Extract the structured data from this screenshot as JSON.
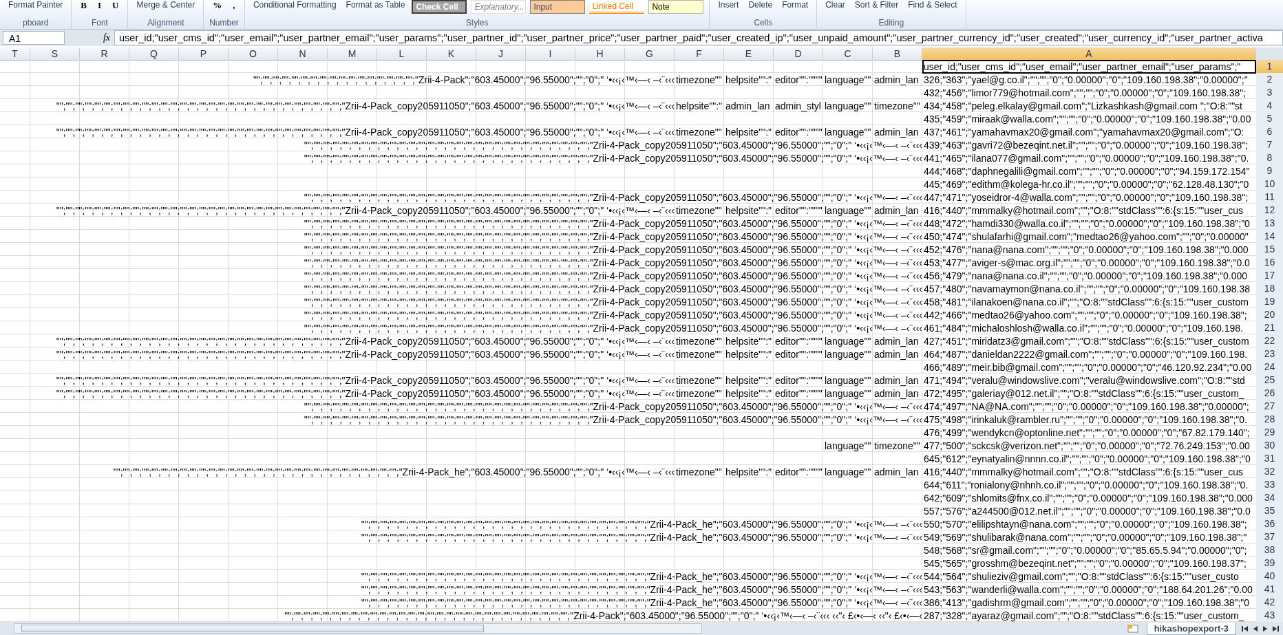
{
  "ribbon": {
    "groups": [
      {
        "label": "pboard",
        "items": [
          {
            "kind": "tool",
            "text": "Format Painter"
          }
        ]
      },
      {
        "label": "Font",
        "items": [
          {
            "kind": "glyph",
            "text": "B"
          },
          {
            "kind": "glyph",
            "text": "I"
          },
          {
            "kind": "glyph",
            "text": "U"
          }
        ]
      },
      {
        "label": "Alignment",
        "items": [
          {
            "kind": "tool",
            "text": "Merge & Center"
          }
        ]
      },
      {
        "label": "Number",
        "items": [
          {
            "kind": "symbol",
            "text": "%"
          },
          {
            "kind": "symbol",
            "text": ","
          }
        ]
      },
      {
        "label": "Styles",
        "items": [
          {
            "kind": "tool",
            "text": "Conditional Formatting"
          },
          {
            "kind": "tool",
            "text": "Format as Table"
          },
          {
            "kind": "check",
            "text": "Check Cell"
          },
          {
            "kind": "explanatory",
            "text": "Explanatory..."
          },
          {
            "kind": "input",
            "text": "Input"
          },
          {
            "kind": "linked",
            "text": "Linked Cell"
          },
          {
            "kind": "note",
            "text": "Note"
          }
        ]
      },
      {
        "label": "Cells",
        "items": [
          {
            "kind": "tool",
            "text": "Insert"
          },
          {
            "kind": "tool",
            "text": "Delete"
          },
          {
            "kind": "tool",
            "text": "Format"
          }
        ]
      },
      {
        "label": "Editing",
        "items": [
          {
            "kind": "tool",
            "text": "Clear"
          },
          {
            "kind": "tool",
            "text": "Sort & Filter"
          },
          {
            "kind": "tool",
            "text": "Find & Select"
          }
        ]
      }
    ]
  },
  "formula_bar": {
    "name_box": "A1",
    "fx": "fx",
    "formula": "user_id;\"user_cms_id\";\"user_email\";\"user_partner_email\";\"user_params\";\"user_partner_id\";\"user_partner_price\";\"user_partner_paid\";\"user_created_ip\";\"user_unpaid_amount\";\"user_partner_currency_id\";\"user_created\";\"user_currency_id\";\"user_partner_activa"
  },
  "columns": [
    {
      "label": "T",
      "selected": false
    },
    {
      "label": "S",
      "selected": false
    },
    {
      "label": "R",
      "selected": false
    },
    {
      "label": "Q",
      "selected": false
    },
    {
      "label": "P",
      "selected": false
    },
    {
      "label": "O",
      "selected": false
    },
    {
      "label": "N",
      "selected": false
    },
    {
      "label": "M",
      "selected": false
    },
    {
      "label": "L",
      "selected": false
    },
    {
      "label": "K",
      "selected": false
    },
    {
      "label": "J",
      "selected": false
    },
    {
      "label": "I",
      "selected": false
    },
    {
      "label": "H",
      "selected": false
    },
    {
      "label": "G",
      "selected": false
    },
    {
      "label": "F",
      "selected": false
    },
    {
      "label": "E",
      "selected": false
    },
    {
      "label": "D",
      "selected": false
    },
    {
      "label": "C",
      "selected": false
    },
    {
      "label": "B",
      "selected": false
    },
    {
      "label": "A",
      "selected": true
    }
  ],
  "rows": [
    {
      "number": "1",
      "selected": true,
      "cells": [
        {
          "kind": "text",
          "text": "user_id;\"user_cms_id\";\"user_email\";\"user_partner_email\";\"user_params\";\""
        }
      ]
    },
    {
      "number": "2",
      "selected": false,
      "cells": [
        {
          "kind": "overflow",
          "text": "\"\";\"\";\"\";\"\";\"\";\"\";\"\";\"\";\"\";\"\";\"\";\"\";\"\";\"\";\"\";\"\";\"\";\"Zrii-4-Pack\";\"603.45000\";\"96.55000\";\"\";\"0\";\" ‘•‹‹¡‹™‹—‹ –‹¨‹‹‹"
        },
        {
          "kind": "text",
          "text": "timezone\"\""
        },
        {
          "kind": "text",
          "text": "helpsite\"\":\""
        },
        {
          "kind": "text",
          "text": "editor\"\":\"\"\"\""
        },
        {
          "kind": "text",
          "text": "language\"\""
        },
        {
          "kind": "text",
          "text": "admin_lan"
        },
        {
          "kind": "text",
          "text": "326;\"363\";\"yael@g.co.il\";\"\";\"\";\"0\";\"0.00000\";\"0\";\"109.160.198.38\";\"0.00000\";\""
        }
      ]
    },
    {
      "number": "3",
      "selected": false,
      "cells": [
        {
          "kind": "text",
          "text": "432;\"456\";\"limor779@hotmail.com\";\"\";\"\";\"0\";\"0.00000\";\"0\";\"109.160.198.38\";"
        }
      ]
    },
    {
      "number": "4",
      "selected": false,
      "cells": [
        {
          "kind": "overflow",
          "text": "\"\";\"\";\"\";\"\";\"\";\"\";\"\";\"\";\"\";\"\";\"\";\"\";\"\";\"\";\"\";\"\";\"\";\"\";\"\";\"\";\"\";\"\";\"\";\"\";\"\";\"\";\"\";\"\";\"\";\"\";\"Zrii-4-Pack_copy205911050\";\"603.45000\";\"96.55000\";\"\";\"0\";\" ‘•‹‹¡‹™‹—‹ –‹¨‹‹‹"
        },
        {
          "kind": "text",
          "text": "helpsite\"\":\""
        },
        {
          "kind": "text",
          "text": "admin_lan"
        },
        {
          "kind": "text",
          "text": "admin_styl"
        },
        {
          "kind": "text",
          "text": "language\"\""
        },
        {
          "kind": "text",
          "text": "timezone\"\""
        },
        {
          "kind": "text",
          "text": "434;\"458\";\"peleg.elkalay@gmail.com\";\"Lizkashkash@gmail.com \";\"O:8:\"\"st"
        }
      ]
    },
    {
      "number": "5",
      "selected": false,
      "cells": [
        {
          "kind": "text",
          "text": "435;\"459\";\"miraak@walla.com\";\"\";\"\";\"0\";\"0.00000\";\"0\";\"109.160.198.38\";\"0.00"
        }
      ]
    },
    {
      "number": "6",
      "selected": false,
      "cells": [
        {
          "kind": "overflow",
          "text": "\"\";\"\";\"\";\"\";\"\";\"\";\"\";\"\";\"\";\"\";\"\";\"\";\"\";\"\";\"\";\"\";\"\";\"\";\"\";\"\";\"\";\"\";\"\";\"\";\"\";\"\";\"\";\"\";\"\";\"\";\"Zrii-4-Pack_copy205911050\";\"603.45000\";\"96.55000\";\"\";\"0\";\" ‘•‹‹¡‹™‹—‹ –‹¨‹‹‹"
        },
        {
          "kind": "text",
          "text": "timezone\"\""
        },
        {
          "kind": "text",
          "text": "helpsite\"\":\""
        },
        {
          "kind": "text",
          "text": "editor\"\":\"\"\"\""
        },
        {
          "kind": "text",
          "text": "language\"\""
        },
        {
          "kind": "text",
          "text": "admin_lan"
        },
        {
          "kind": "text",
          "text": "437;\"461\";\"yamahavmax20@gmail.com\";\"yamahavmax20@gmail.com\";\"O:"
        }
      ]
    },
    {
      "number": "7",
      "selected": false,
      "cells": [
        {
          "kind": "overflow",
          "text": "\"\";\"\";\"\";\"\";\"\";\"\";\"\";\"\";\"\";\"\";\"\";\"\";\"\";\"\";\"\";\"\";\"\";\"\";\"\";\"\";\"\";\"\";\"\";\"\";\"\";\"\";\"\";\"\";\"\";\"\";\"Zrii-4-Pack_copy205911050\";\"603.45000\";\"96.55000\";\"\";\"0\";\" ‘•‹‹¡‹™‹—‹ –‹¨‹‹‹"
        },
        {
          "kind": "text",
          "text": "439;\"463\";\"gavri72@bezeqint.net.il\";\"\";\"\";\"0\";\"0.00000\";\"0\";\"109.160.198.38\";"
        }
      ]
    },
    {
      "number": "8",
      "selected": false,
      "cells": [
        {
          "kind": "overflow",
          "text": "\"\";\"\";\"\";\"\";\"\";\"\";\"\";\"\";\"\";\"\";\"\";\"\";\"\";\"\";\"\";\"\";\"\";\"\";\"\";\"\";\"\";\"\";\"\";\"\";\"\";\"\";\"\";\"\";\"\";\"\";\"Zrii-4-Pack_copy205911050\";\"603.45000\";\"96.55000\";\"\";\"0\";\" ‘•‹‹¡‹™‹—‹ –‹¨‹‹‹"
        },
        {
          "kind": "text",
          "text": "441;\"465\";\"ilana077@gmail.com\";\"\";\"\";\"0\";\"0.00000\";\"0\";\"109.160.198.38\";\"0."
        }
      ]
    },
    {
      "number": "9",
      "selected": false,
      "cells": [
        {
          "kind": "text",
          "text": "444;\"468\";\"daphnegalili@gmail.com\";\"\";\"\";\"0\";\"0.00000\";\"0\";\"94.159.172.154\""
        }
      ]
    },
    {
      "number": "10",
      "selected": false,
      "cells": [
        {
          "kind": "text",
          "text": "445;\"469\";\"edithm@kolega-hr.co.il\";\"\";\"\";\"0\";\"0.00000\";\"0\";\"62.128.48.130\";\"0"
        }
      ]
    },
    {
      "number": "11",
      "selected": false,
      "cells": [
        {
          "kind": "overflow",
          "text": "\"\";\"\";\"\";\"\";\"\";\"\";\"\";\"\";\"\";\"\";\"\";\"\";\"\";\"\";\"\";\"\";\"\";\"\";\"\";\"\";\"\";\"\";\"\";\"\";\"\";\"\";\"\";\"\";\"\";\"\";\"Zrii-4-Pack_copy205911050\";\"603.45000\";\"96.55000\";\"\";\"0\";\" ‘•‹‹¡‹™‹—‹ –‹¨‹‹‹"
        },
        {
          "kind": "text",
          "text": "447;\"471\";\"yoseidror-4@walla.com\";\"\";\"\";\"0\";\"0.00000\";\"0\";\"109.160.198.38\";"
        }
      ]
    },
    {
      "number": "12",
      "selected": false,
      "cells": [
        {
          "kind": "overflow",
          "text": "\"\";\"\";\"\";\"\";\"\";\"\";\"\";\"\";\"\";\"\";\"\";\"\";\"\";\"\";\"\";\"\";\"\";\"\";\"\";\"\";\"\";\"\";\"\";\"\";\"\";\"\";\"\";\"\";\"\";\"\";\"Zrii-4-Pack_copy205911050\";\"603.45000\";\"96.55000\";\"\";\"0\";\" ‘•‹‹¡‹™‹—‹ –‹¨‹‹‹"
        },
        {
          "kind": "text",
          "text": "timezone\"\""
        },
        {
          "kind": "text",
          "text": "helpsite\"\":\""
        },
        {
          "kind": "text",
          "text": "editor\"\":\"\"\"\""
        },
        {
          "kind": "text",
          "text": "language\"\""
        },
        {
          "kind": "text",
          "text": "admin_lan"
        },
        {
          "kind": "text",
          "text": "416;\"440\";\"mmmalky@hotmail.com\";\"\";\"O:8:\"\"stdClass\"\":6:{s:15:\"\"user_cus"
        }
      ]
    },
    {
      "number": "13",
      "selected": false,
      "cells": [
        {
          "kind": "overflow",
          "text": "\"\";\"\";\"\";\"\";\"\";\"\";\"\";\"\";\"\";\"\";\"\";\"\";\"\";\"\";\"\";\"\";\"\";\"\";\"\";\"\";\"\";\"\";\"\";\"\";\"\";\"\";\"\";\"\";\"\";\"\";\"Zrii-4-Pack_copy205911050\";\"603.45000\";\"96.55000\";\"\";\"0\";\" ‘•‹‹¡‹™‹—‹ –‹¨‹‹‹"
        },
        {
          "kind": "text",
          "text": "448;\"472\";\"hamdi330@walla.co.il\";\"\";\"\";\"0\";\"0.00000\";\"0\";\"109.160.198.38\";\"0"
        }
      ]
    },
    {
      "number": "14",
      "selected": false,
      "cells": [
        {
          "kind": "overflow",
          "text": "\"\";\"\";\"\";\"\";\"\";\"\";\"\";\"\";\"\";\"\";\"\";\"\";\"\";\"\";\"\";\"\";\"\";\"\";\"\";\"\";\"\";\"\";\"\";\"\";\"\";\"\";\"\";\"\";\"\";\"\";\"Zrii-4-Pack_copy205911050\";\"603.45000\";\"96.55000\";\"\";\"0\";\" ‘•‹‹¡‹™‹—‹ –‹¨‹‹‹"
        },
        {
          "kind": "text",
          "text": "450;\"474\";\"shulafarhi@gmail.com\";\"medtao26@yahoo.com\";\"\";\"0\";\"0.00000\""
        }
      ]
    },
    {
      "number": "15",
      "selected": false,
      "cells": [
        {
          "kind": "overflow",
          "text": "\"\";\"\";\"\";\"\";\"\";\"\";\"\";\"\";\"\";\"\";\"\";\"\";\"\";\"\";\"\";\"\";\"\";\"\";\"\";\"\";\"\";\"\";\"\";\"\";\"\";\"\";\"\";\"\";\"\";\"\";\"Zrii-4-Pack_copy205911050\";\"603.45000\";\"96.55000\";\"\";\"0\";\" ‘•‹‹¡‹™‹—‹ –‹¨‹‹‹"
        },
        {
          "kind": "text",
          "text": "452;\"476\";\"nana@nana.com\";\"\";\"\";\"0\";\"0.00000\";\"0\";\"109.160.198.38\";\"0.000"
        }
      ]
    },
    {
      "number": "16",
      "selected": false,
      "cells": [
        {
          "kind": "overflow",
          "text": "\"\";\"\";\"\";\"\";\"\";\"\";\"\";\"\";\"\";\"\";\"\";\"\";\"\";\"\";\"\";\"\";\"\";\"\";\"\";\"\";\"\";\"\";\"\";\"\";\"\";\"\";\"\";\"\";\"\";\"\";\"Zrii-4-Pack_copy205911050\";\"603.45000\";\"96.55000\";\"\";\"0\";\" ‘•‹‹¡‹™‹—‹ –‹¨‹‹‹"
        },
        {
          "kind": "text",
          "text": "453;\"477\";\"aviger-s@mac.org.il\";\"\";\"\";\"0\";\"0.00000\";\"0\";\"109.160.198.38\";\"0.0"
        }
      ]
    },
    {
      "number": "17",
      "selected": false,
      "cells": [
        {
          "kind": "overflow",
          "text": "\"\";\"\";\"\";\"\";\"\";\"\";\"\";\"\";\"\";\"\";\"\";\"\";\"\";\"\";\"\";\"\";\"\";\"\";\"\";\"\";\"\";\"\";\"\";\"\";\"\";\"\";\"\";\"\";\"\";\"\";\"Zrii-4-Pack_copy205911050\";\"603.45000\";\"96.55000\";\"\";\"0\";\" ‘•‹‹¡‹™‹—‹ –‹¨‹‹‹"
        },
        {
          "kind": "text",
          "text": "456;\"479\";\"nana@nana.co.il\";\"\";\"\";\"0\";\"0.00000\";\"0\";\"109.160.198.38\";\"0.000"
        }
      ]
    },
    {
      "number": "18",
      "selected": false,
      "cells": [
        {
          "kind": "overflow",
          "text": "\"\";\"\";\"\";\"\";\"\";\"\";\"\";\"\";\"\";\"\";\"\";\"\";\"\";\"\";\"\";\"\";\"\";\"\";\"\";\"\";\"\";\"\";\"\";\"\";\"\";\"\";\"\";\"\";\"\";\"\";\"Zrii-4-Pack_copy205911050\";\"603.45000\";\"96.55000\";\"\";\"0\";\" ‘•‹‹¡‹™‹—‹ –‹¨‹‹‹"
        },
        {
          "kind": "text",
          "text": "457;\"480\";\"navamaymon@nana.co.il\";\"\";\"\";\"0\";\"0.00000\";\"0\";\"109.160.198.38"
        }
      ]
    },
    {
      "number": "19",
      "selected": false,
      "cells": [
        {
          "kind": "overflow",
          "text": "\"\";\"\";\"\";\"\";\"\";\"\";\"\";\"\";\"\";\"\";\"\";\"\";\"\";\"\";\"\";\"\";\"\";\"\";\"\";\"\";\"\";\"\";\"\";\"\";\"\";\"\";\"\";\"\";\"\";\"\";\"Zrii-4-Pack_copy205911050\";\"603.45000\";\"96.55000\";\"\";\"0\";\" ‘•‹‹¡‹™‹—‹ –‹¨‹‹‹"
        },
        {
          "kind": "text",
          "text": "458;\"481\";\"ilanakoen@nana.co.il\";\"\";\"O:8:\"\"stdClass\"\":6:{s:15:\"\"user_custom"
        }
      ]
    },
    {
      "number": "20",
      "selected": false,
      "cells": [
        {
          "kind": "overflow",
          "text": "\"\";\"\";\"\";\"\";\"\";\"\";\"\";\"\";\"\";\"\";\"\";\"\";\"\";\"\";\"\";\"\";\"\";\"\";\"\";\"\";\"\";\"\";\"\";\"\";\"\";\"\";\"\";\"\";\"\";\"\";\"Zrii-4-Pack_copy205911050\";\"603.45000\";\"96.55000\";\"\";\"0\";\" ‘•‹‹¡‹™‹—‹ –‹¨‹‹‹"
        },
        {
          "kind": "text",
          "text": "442;\"466\";\"medtao26@yahoo.com\";\"\";\"\";\"0\";\"0.00000\";\"0\";\"109.160.198.38\";"
        }
      ]
    },
    {
      "number": "21",
      "selected": false,
      "cells": [
        {
          "kind": "overflow",
          "text": "\"\";\"\";\"\";\"\";\"\";\"\";\"\";\"\";\"\";\"\";\"\";\"\";\"\";\"\";\"\";\"\";\"\";\"\";\"\";\"\";\"\";\"\";\"\";\"\";\"\";\"\";\"\";\"\";\"\";\"\";\"Zrii-4-Pack_copy205911050\";\"603.45000\";\"96.55000\";\"\";\"0\";\" ‘•‹‹¡‹™‹—‹ –‹¨‹‹‹"
        },
        {
          "kind": "text",
          "text": "461;\"484\";\"michaloshlosh@walla.co.il\";\"\";\"\";\"0\";\"0.00000\";\"0\";\"109.160.198."
        }
      ]
    },
    {
      "number": "22",
      "selected": false,
      "cells": [
        {
          "kind": "overflow",
          "text": "\"\";\"\";\"\";\"\";\"\";\"\";\"\";\"\";\"\";\"\";\"\";\"\";\"\";\"\";\"\";\"\";\"\";\"\";\"\";\"\";\"\";\"\";\"\";\"\";\"\";\"\";\"\";\"\";\"\";\"\";\"Zrii-4-Pack_copy205911050\";\"603.45000\";\"96.55000\";\"\";\"0\";\" ‘•‹‹¡‹™‹—‹ –‹¨‹‹‹"
        },
        {
          "kind": "text",
          "text": "timezone\"\""
        },
        {
          "kind": "text",
          "text": "helpsite\"\":\""
        },
        {
          "kind": "text",
          "text": "editor\"\":\"\"\"\""
        },
        {
          "kind": "text",
          "text": "language\"\""
        },
        {
          "kind": "text",
          "text": "admin_lan"
        },
        {
          "kind": "text",
          "text": "427;\"451\";\"miridatz3@gmail.com\";\"\";\"O:8:\"\"stdClass\"\":6:{s:15:\"\"user_custom"
        }
      ]
    },
    {
      "number": "23",
      "selected": false,
      "cells": [
        {
          "kind": "overflow",
          "text": "\"\";\"\";\"\";\"\";\"\";\"\";\"\";\"\";\"\";\"\";\"\";\"\";\"\";\"\";\"\";\"\";\"\";\"\";\"\";\"\";\"\";\"\";\"\";\"\";\"\";\"\";\"\";\"\";\"\";\"\";\"Zrii-4-Pack_copy205911050\";\"603.45000\";\"96.55000\";\"\";\"0\";\" ‘•‹‹¡‹™‹—‹ –‹¨‹‹‹"
        },
        {
          "kind": "text",
          "text": "timezone\"\""
        },
        {
          "kind": "text",
          "text": "helpsite\"\":\""
        },
        {
          "kind": "text",
          "text": "editor\"\":\"\"\"\""
        },
        {
          "kind": "text",
          "text": "language\"\""
        },
        {
          "kind": "text",
          "text": "admin_lan"
        },
        {
          "kind": "text",
          "text": "464;\"487\";\"danieldan2222@gmail.com\";\"\";\"\";\"0\";\"0.00000\";\"0\";\"109.160.198."
        }
      ]
    },
    {
      "number": "24",
      "selected": false,
      "cells": [
        {
          "kind": "text",
          "text": "466;\"489\";\"meir.bib@gmail.com\";\"\";\"\";\"0\";\"0.00000\";\"0\";\"46.120.92.234\";\"0.00"
        }
      ]
    },
    {
      "number": "25",
      "selected": false,
      "cells": [
        {
          "kind": "overflow",
          "text": "\"\";\"\";\"\";\"\";\"\";\"\";\"\";\"\";\"\";\"\";\"\";\"\";\"\";\"\";\"\";\"\";\"\";\"\";\"\";\"\";\"\";\"\";\"\";\"\";\"\";\"\";\"\";\"\";\"\";\"\";\"Zrii-4-Pack_copy205911050\";\"603.45000\";\"96.55000\";\"\";\"0\";\" ‘•‹‹¡‹™‹—‹ –‹¨‹‹‹"
        },
        {
          "kind": "text",
          "text": "timezone\"\""
        },
        {
          "kind": "text",
          "text": "helpsite\"\":\""
        },
        {
          "kind": "text",
          "text": "editor\"\":\"\"\"\""
        },
        {
          "kind": "text",
          "text": "language\"\""
        },
        {
          "kind": "text",
          "text": "admin_lan"
        },
        {
          "kind": "text",
          "text": "471;\"494\";\"veralu@windowslive.com\";\"veralu@windowslive.com\";\"O:8:\"\"std"
        }
      ]
    },
    {
      "number": "26",
      "selected": false,
      "cells": [
        {
          "kind": "overflow",
          "text": "\"\";\"\";\"\";\"\";\"\";\"\";\"\";\"\";\"\";\"\";\"\";\"\";\"\";\"\";\"\";\"\";\"\";\"\";\"\";\"\";\"\";\"\";\"\";\"\";\"\";\"\";\"\";\"\";\"\";\"\";\"Zrii-4-Pack_copy205911050\";\"603.45000\";\"96.55000\";\"\";\"0\";\" ‘•‹‹¡‹™‹—‹ –‹¨‹‹‹"
        },
        {
          "kind": "text",
          "text": "timezone\"\""
        },
        {
          "kind": "text",
          "text": "helpsite\"\":\""
        },
        {
          "kind": "text",
          "text": "editor\"\":\"\"\"\""
        },
        {
          "kind": "text",
          "text": "language\"\""
        },
        {
          "kind": "text",
          "text": "admin_lan"
        },
        {
          "kind": "text",
          "text": "472;\"495\";\"galeriay@012.net.il\";\"\";\"O:8:\"\"stdClass\"\":6:{s:15:\"\"user_custom_"
        }
      ]
    },
    {
      "number": "27",
      "selected": false,
      "cells": [
        {
          "kind": "overflow",
          "text": "\"\";\"\";\"\";\"\";\"\";\"\";\"\";\"\";\"\";\"\";\"\";\"\";\"\";\"\";\"\";\"\";\"\";\"\";\"\";\"\";\"\";\"\";\"\";\"\";\"\";\"\";\"\";\"\";\"\";\"\";\"Zrii-4-Pack_copy205911050\";\"603.45000\";\"96.55000\";\"\";\"0\";\" ‘•‹‹¡‹™‹—‹ –‹¨‹‹‹"
        },
        {
          "kind": "text",
          "text": "474;\"497\";\"NA@NA.com\";\"\";\"\";\"0\";\"0.00000\";\"0\";\"109.160.198.38\";\"0.00000\";"
        }
      ]
    },
    {
      "number": "28",
      "selected": false,
      "cells": [
        {
          "kind": "overflow",
          "text": "\"\";\"\";\"\";\"\";\"\";\"\";\"\";\"\";\"\";\"\";\"\";\"\";\"\";\"\";\"\";\"\";\"\";\"\";\"\";\"\";\"\";\"\";\"\";\"\";\"\";\"\";\"\";\"\";\"\";\"\";\"Zrii-4-Pack_copy205911050\";\"603.45000\";\"96.55000\";\"\";\"0\";\" ‘•‹‹¡‹™‹—‹ –‹¨‹‹‹"
        },
        {
          "kind": "text",
          "text": "475;\"498\";\"irinkaluk@rambler.ru\";\"\";\"\";\"0\";\"0.00000\";\"0\";\"109.160.198.38\";\"0."
        }
      ]
    },
    {
      "number": "29",
      "selected": false,
      "cells": [
        {
          "kind": "text",
          "text": "476;\"499\";\"wendykcn@optonline.net\";\"\";\"\";\"0\";\"0.00000\";\"0\";\"67.82.179.140\";"
        }
      ]
    },
    {
      "number": "30",
      "selected": false,
      "cells": [
        {
          "kind": "text",
          "text": "language\"\""
        },
        {
          "kind": "text",
          "text": "timezone\"\""
        },
        {
          "kind": "text",
          "text": "477;\"500\";\"sckcsk@verizon.net\";\"\";\"\";\"0\";\"0.00000\";\"0\";\"72.76.249.153\";\"0.00"
        }
      ]
    },
    {
      "number": "31",
      "selected": false,
      "cells": [
        {
          "kind": "text",
          "text": "645;\"612\";\"eynatyalin@nnnn.co.il\";\"\";\"\";\"0\";\"0.00000\";\"0\";\"109.160.198.38\";\"0"
        }
      ]
    },
    {
      "number": "32",
      "selected": false,
      "cells": [
        {
          "kind": "overflow",
          "text": "\"\";\"\";\"\";\"\";\"\";\"\";\"\";\"\";\"\";\"\";\"\";\"\";\"\";\"\";\"\";\"\";\"\";\"\";\"\";\"\";\"\";\"\";\"\";\"\";\"\";\"\";\"\";\"\";\"\";\"\";\"Zrii-4-Pack_he\";\"603.45000\";\"96.55000\";\"\";\"0\";\" ‘•‹‹¡‹™‹—‹ –‹¨‹‹‹"
        },
        {
          "kind": "text",
          "text": "timezone\"\""
        },
        {
          "kind": "text",
          "text": "helpsite\"\":\""
        },
        {
          "kind": "text",
          "text": "editor\"\":\"\"\"\""
        },
        {
          "kind": "text",
          "text": "language\"\""
        },
        {
          "kind": "text",
          "text": "admin_lan"
        },
        {
          "kind": "text",
          "text": "416;\"440\";\"mmmalky@hotmail.com\";\"\";\"O:8:\"\"stdClass\"\":6:{s:15:\"\"user_cus"
        }
      ]
    },
    {
      "number": "33",
      "selected": false,
      "cells": [
        {
          "kind": "text",
          "text": "644;\"611\";\"ronialony@nhnh.co.il\";\"\";\"\";\"0\";\"0.00000\";\"0\";\"109.160.198.38\";\"0."
        }
      ]
    },
    {
      "number": "34",
      "selected": false,
      "cells": [
        {
          "kind": "text",
          "text": "642;\"609\";\"shlomits@fnx.co.il\";\"\";\"\";\"0\";\"0.00000\";\"0\";\"109.160.198.38\";\"0.000"
        }
      ]
    },
    {
      "number": "35",
      "selected": false,
      "cells": [
        {
          "kind": "text",
          "text": "557;\"576\";\"a244500@012.net.il\";\"\";\"\";\"0\";\"0.00000\";\"0\";\"109.160.198.38\";\"0.0"
        }
      ]
    },
    {
      "number": "36",
      "selected": false,
      "cells": [
        {
          "kind": "overflow",
          "text": "\"\";\"\";\"\";\"\";\"\";\"\";\"\";\"\";\"\";\"\";\"\";\"\";\"\";\"\";\"\";\"\";\"\";\"\";\"\";\"\";\"\";\"\";\"\";\"\";\"\";\"\";\"\";\"\";\"\";\"\";\"Zrii-4-Pack_he\";\"603.45000\";\"96.55000\";\"\";\"0\";\" ‘•‹‹¡‹™‹—‹ –‹¨‹‹‹"
        },
        {
          "kind": "text",
          "text": "550;\"570\";\"elilipshtayn@nana.com\";\"\";\"\";\"0\";\"0.00000\";\"0\";\"109.160.198.38\";"
        }
      ]
    },
    {
      "number": "37",
      "selected": false,
      "cells": [
        {
          "kind": "overflow",
          "text": "\"\";\"\";\"\";\"\";\"\";\"\";\"\";\"\";\"\";\"\";\"\";\"\";\"\";\"\";\"\";\"\";\"\";\"\";\"\";\"\";\"\";\"\";\"\";\"\";\"\";\"\";\"\";\"\";\"\";\"\";\"Zrii-4-Pack_he\";\"603.45000\";\"96.55000\";\"\";\"0\";\" ‘•‹‹¡‹™‹—‹ –‹¨‹‹‹"
        },
        {
          "kind": "text",
          "text": "549;\"569\";\"shulibarak@nana.com\";\"\";\"\";\"0\";\"0.00000\";\"0\";\"109.160.198.38\";\""
        }
      ]
    },
    {
      "number": "38",
      "selected": false,
      "cells": [
        {
          "kind": "text",
          "text": "548;\"568\";\"sr@gmail.com\";\"\";\"\";\"0\";\"0.00000\";\"0\";\"85.65.5.94\";\"0.00000\";\"0\";"
        }
      ]
    },
    {
      "number": "39",
      "selected": false,
      "cells": [
        {
          "kind": "text",
          "text": "545;\"565\";\"grosshm@bezeqint.net\";\"\";\"\";\"0\";\"0.00000\";\"0\";\"109.160.198.37\";"
        }
      ]
    },
    {
      "number": "40",
      "selected": false,
      "cells": [
        {
          "kind": "overflow",
          "text": "\"\";\"\";\"\";\"\";\"\";\"\";\"\";\"\";\"\";\"\";\"\";\"\";\"\";\"\";\"\";\"\";\"\";\"\";\"\";\"\";\"\";\"\";\"\";\"\";\"\";\"\";\"\";\"\";\"\";\"\";\"Zrii-4-Pack_he\";\"603.45000\";\"96.55000\";\"\";\"0\";\" ‘•‹‹¡‹™‹—‹ –‹¨‹‹‹"
        },
        {
          "kind": "text",
          "text": "544;\"564\";\"shulieziv@gmail.com\";\"\";\"O:8:\"\"stdClass\"\":6:{s:15:\"\"user_custo"
        }
      ]
    },
    {
      "number": "41",
      "selected": false,
      "cells": [
        {
          "kind": "overflow",
          "text": "\"\";\"\";\"\";\"\";\"\";\"\";\"\";\"\";\"\";\"\";\"\";\"\";\"\";\"\";\"\";\"\";\"\";\"\";\"\";\"\";\"\";\"\";\"\";\"\";\"\";\"\";\"\";\"\";\"\";\"\";\"Zrii-4-Pack_he\";\"603.45000\";\"96.55000\";\"\";\"0\";\" ‘•‹‹¡‹™‹—‹ –‹¨‹‹‹"
        },
        {
          "kind": "text",
          "text": "543;\"563\";\"wanderli@walla.com\";\"\";\"\";\"0\";\"0.00000\";\"0\";\"188.64.201.26\";\"0.00"
        }
      ]
    },
    {
      "number": "42",
      "selected": false,
      "cells": [
        {
          "kind": "overflow",
          "text": "\"\";\"\";\"\";\"\";\"\";\"\";\"\";\"\";\"\";\"\";\"\";\"\";\"\";\"\";\"\";\"\";\"\";\"\";\"\";\"\";\"\";\"\";\"\";\"\";\"\";\"\";\"\";\"\";\"\";\"\";\"Zrii-4-Pack_he\";\"603.45000\";\"96.55000\";\"\";\"0\";\" ‘•‹‹¡‹™‹—‹ –‹¨‹‹‹"
        },
        {
          "kind": "text",
          "text": "386;\"413\";\"gadishrm@gmail.com\";\"\";\"\";\"0\";\"0.00000\";\"0\";\"109.160.198.38\";\"0"
        }
      ]
    },
    {
      "number": "43",
      "selected": false,
      "cells": [
        {
          "kind": "overflow",
          "text": "\"\";\"\";\"\";\"\";\"\";\"\";\"\";\"\";\"\";\"\";\"\";\"\";\"\";\"\";\"\";\"\";\"\";\"\";\"\";\"\";\"\";\"\";\"\";\"\";\"\";\"\";\"\";\"\";\"\";\"\";\"Zrii-4-Pack\";\"603.45000\";\"96.55000\";\"\";\"0\";\" ‘•‹‹¡‹™‹—‹ –‹¨‹‹‹ ‹‹\"‹ £‹•‹—‹ ‹‹\"‹ £‹•‹—‹"
        },
        {
          "kind": "text",
          "text": "287;\"328\";\"ayaraz@gmail.com\";\"\";\"O:8:\"\"stdClass\"\":6:{s:15:\"\"user_custom_"
        }
      ]
    }
  ],
  "sheet_tabs": [
    {
      "label": "hikashopexport-3",
      "selected": true
    }
  ]
}
